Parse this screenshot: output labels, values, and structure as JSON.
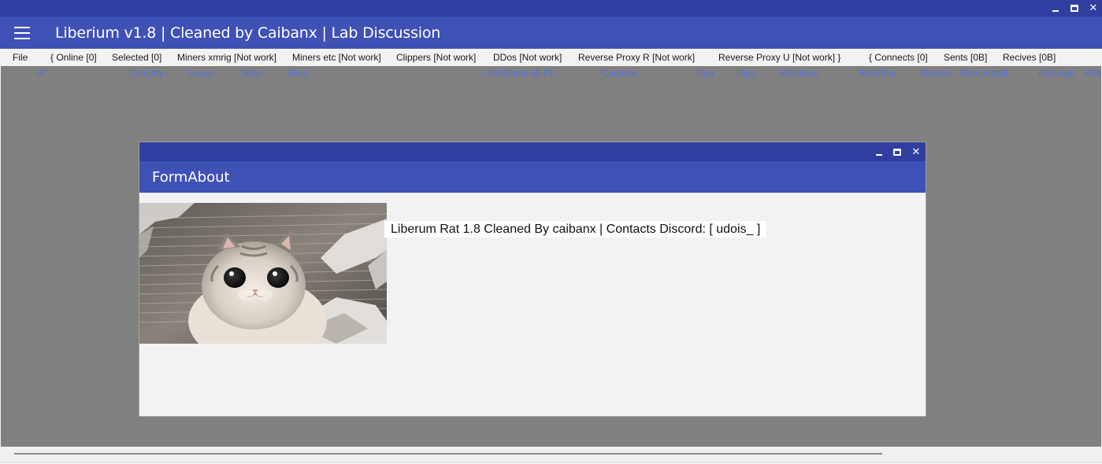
{
  "app": {
    "title": "Liberium v1.8 | Cleaned by Caibanx | Lab Discussion"
  },
  "window_controls": {
    "minimize_icon": "minimize-icon",
    "maximize_icon": "maximize-icon",
    "close_label": "✕"
  },
  "menu": {
    "items": [
      "File",
      "{ Online [0]",
      "Selected [0]",
      "Miners xmrig [Not work]",
      "Miners etc [Not work]",
      "Clippers [Not work]",
      "DDos [Not work]",
      "Reverse Proxy R [Not work]",
      "Reverse Proxy U [Not work] }",
      "{ Connects [0]",
      "Sents [0B]",
      "Recives [0B]"
    ]
  },
  "grid": {
    "columns": [
      "IP",
      "Country",
      "Group",
      "Note",
      "Hwid",
      "UserName @ Pc",
      "Camera",
      "Cpu",
      "Gpu",
      "Windows",
      "AntiVirus",
      "Version",
      "Time Install",
      "Privilege",
      "Ping"
    ]
  },
  "about": {
    "title": "FormAbout",
    "text": "Liberum Rat 1.8 Cleaned By caibanx | Contacts Discord: [ udois_ ]",
    "image_subject": "cat-photo"
  },
  "colors": {
    "titlebar": "#303f9f",
    "header": "#3f51b5",
    "grid_background": "#808080",
    "column_header_text": "#5470e0",
    "window_background": "#f2f2f2"
  }
}
